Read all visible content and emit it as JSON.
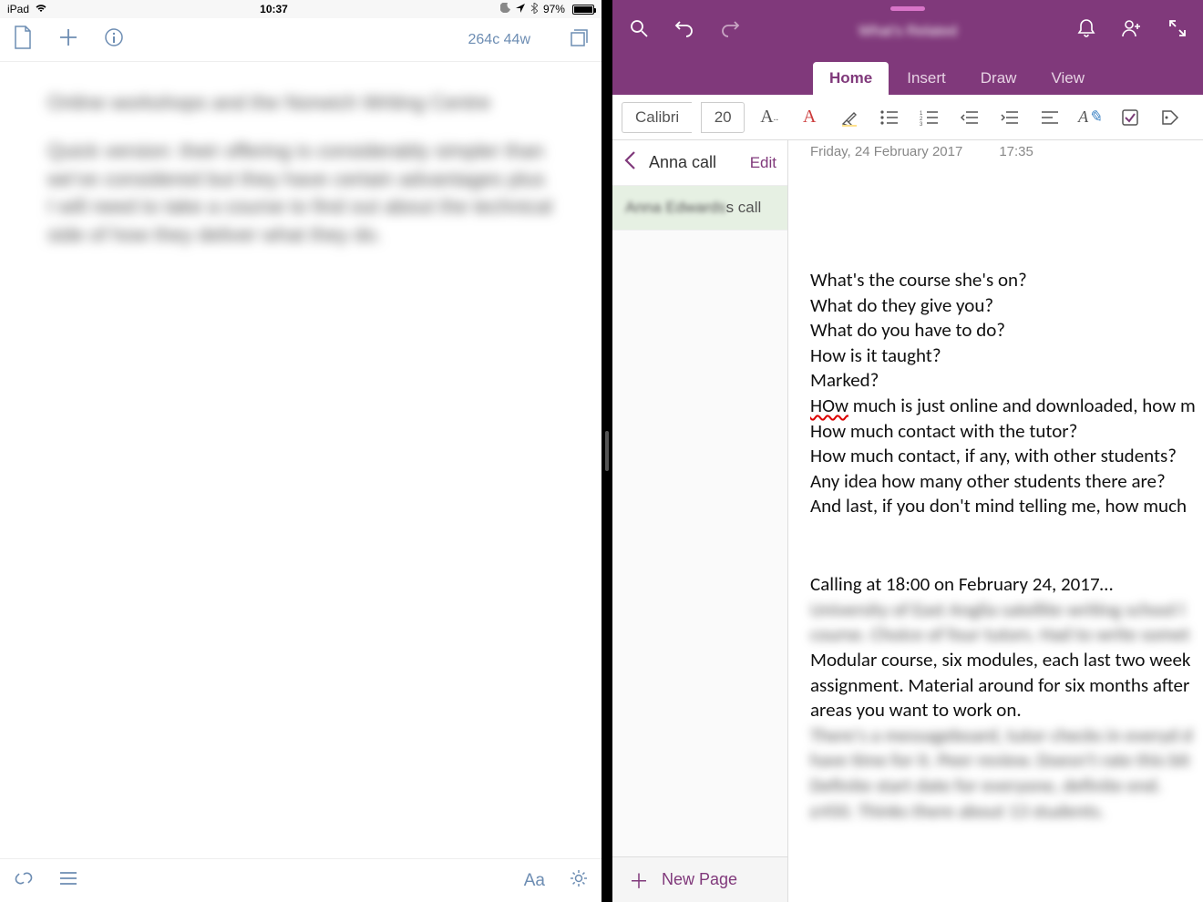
{
  "statusbar": {
    "device": "iPad",
    "time": "10:37",
    "battery_pct": "97%"
  },
  "left": {
    "word_count": "264c 44w",
    "para1": "Online workshops and the Norwich Writing Centre",
    "para2": "Quick version: their offering is considerably simpler than we've considered but they have certain advantages plus I will need to take a course to find out about the technical side of how they deliver what they do."
  },
  "onenote": {
    "titlebar_text": "What's Related",
    "tabs": [
      "Home",
      "Insert",
      "Draw",
      "View"
    ],
    "active_tab": 0,
    "font_name": "Calibri",
    "font_size": "20",
    "sidebar": {
      "section": "Anna call",
      "edit": "Edit",
      "page_item_prefix": "Anna Edwards",
      "page_item_suffix": "s call",
      "new_page": "New Page"
    },
    "meta": {
      "date": "Friday, 24 February 2017",
      "time": "17:35"
    },
    "note": {
      "lines": [
        "What's the course she's on?",
        "What do they give you?",
        "What do you have to do?",
        "How is it taught?",
        "Marked?",
        "HOw much is just online and downloaded, how m",
        "How much contact with the tutor?",
        "How much contact, if any, with other students?",
        "Any idea how many other students there are?",
        "And last, if you don't mind telling me, how much "
      ],
      "calling": "Calling at 18:00 on February 24, 2017…",
      "blur1": "University of East Anglia satellite writing school l",
      "blur2": "course. Choice of four tutors. Had to write somet",
      "mid1": "Modular course, six modules, each last two week",
      "mid2": "assignment. Material around for six months after",
      "mid3": "areas you want to work on.",
      "blur3": "There's a messageboard, tutor checks in everyd d",
      "blur4": "have time for it. Peer review. Doesn't rate this bit",
      "blur5": "Definite start date for everyone, definite end.",
      "blur6": "£450. Thinks there about 13 students."
    }
  }
}
